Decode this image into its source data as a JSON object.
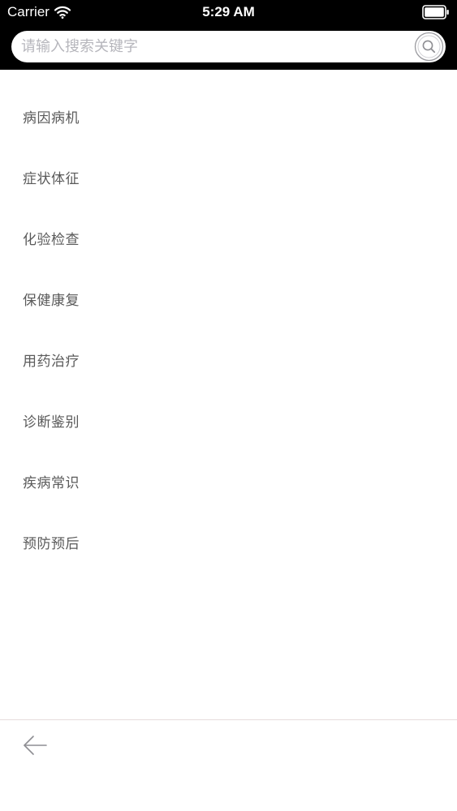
{
  "status_bar": {
    "carrier": "Carrier",
    "time": "5:29 AM",
    "wifi_icon": "wifi-icon",
    "battery_icon": "battery-icon"
  },
  "search": {
    "placeholder": "请输入搜索关键字",
    "value": "",
    "button_icon": "search-icon"
  },
  "categories": [
    {
      "label": "病因病机"
    },
    {
      "label": "症状体征"
    },
    {
      "label": "化验检查"
    },
    {
      "label": "保健康复"
    },
    {
      "label": "用药治疗"
    },
    {
      "label": "诊断鉴别"
    },
    {
      "label": "疾病常识"
    },
    {
      "label": "预防预后"
    }
  ],
  "bottom_bar": {
    "back_icon": "back-arrow-icon"
  },
  "colors": {
    "header_bg": "#000000",
    "search_bg": "#ffffff",
    "placeholder": "#b6b6bc",
    "list_text": "#5a5a5a",
    "divider": "#e6dcdc",
    "icon_gray": "#8e8e93"
  }
}
